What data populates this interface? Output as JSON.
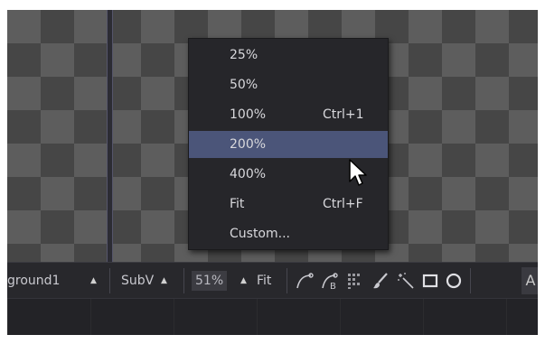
{
  "toolbar": {
    "view_name": "ground1",
    "subview_label": "SubV",
    "zoom_value": "51%",
    "fit_label": "Fit",
    "last_button": "A",
    "arrow": "▲"
  },
  "zoom_menu": {
    "items": [
      {
        "label": "25%",
        "shortcut": ""
      },
      {
        "label": "50%",
        "shortcut": ""
      },
      {
        "label": "100%",
        "shortcut": "Ctrl+1"
      },
      {
        "label": "200%",
        "shortcut": ""
      },
      {
        "label": "400%",
        "shortcut": ""
      },
      {
        "label": "Fit",
        "shortcut": "Ctrl+F"
      },
      {
        "label": "Custom...",
        "shortcut": ""
      }
    ],
    "highlighted_index": 3
  },
  "icons": [
    "spline-tool-icon",
    "bspline-tool-icon",
    "grid-icon",
    "brush-icon",
    "magic-wand-icon",
    "rectangle-tool-icon",
    "ellipse-tool-icon"
  ],
  "colors": {
    "highlight": "#4b5579",
    "menu_bg": "#26262a",
    "checker_light": "#5d5d5d",
    "checker_dark": "#464646"
  }
}
